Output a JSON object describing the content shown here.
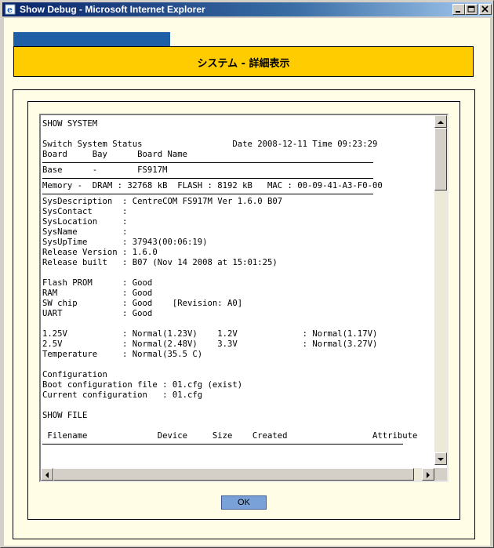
{
  "window": {
    "title": "Show Debug - Microsoft Internet Explorer"
  },
  "banner": {
    "title": "システム - 詳細表示"
  },
  "output": {
    "lines_a": [
      "SHOW SYSTEM",
      "",
      "Switch System Status                  Date 2008-12-11 Time 09:23:29",
      "Board     Bay      Board Name"
    ],
    "lines_b": [
      "Base      -        FS917M"
    ],
    "lines_c": [
      "Memory -  DRAM : 32768 kB  FLASH : 8192 kB   MAC : 00-09-41-A3-F0-00"
    ],
    "lines_d": [
      "SysDescription  : CentreCOM FS917M Ver 1.6.0 B07",
      "SysContact      :",
      "SysLocation     :",
      "SysName         :",
      "SysUpTime       : 37943(00:06:19)",
      "Release Version : 1.6.0",
      "Release built   : B07 (Nov 14 2008 at 15:01:25)",
      "",
      "Flash PROM      : Good",
      "RAM             : Good",
      "SW chip         : Good    [Revision: A0]",
      "UART            : Good",
      "",
      "1.25V           : Normal(1.23V)    1.2V             : Normal(1.17V)",
      "2.5V            : Normal(2.48V)    3.3V             : Normal(3.27V)",
      "Temperature     : Normal(35.5 C)",
      "",
      "Configuration",
      "Boot configuration file : 01.cfg (exist)",
      "Current configuration   : 01.cfg",
      "",
      "SHOW FILE",
      "",
      " Filename              Device     Size    Created                 Attribute"
    ]
  },
  "buttons": {
    "ok": "OK"
  }
}
